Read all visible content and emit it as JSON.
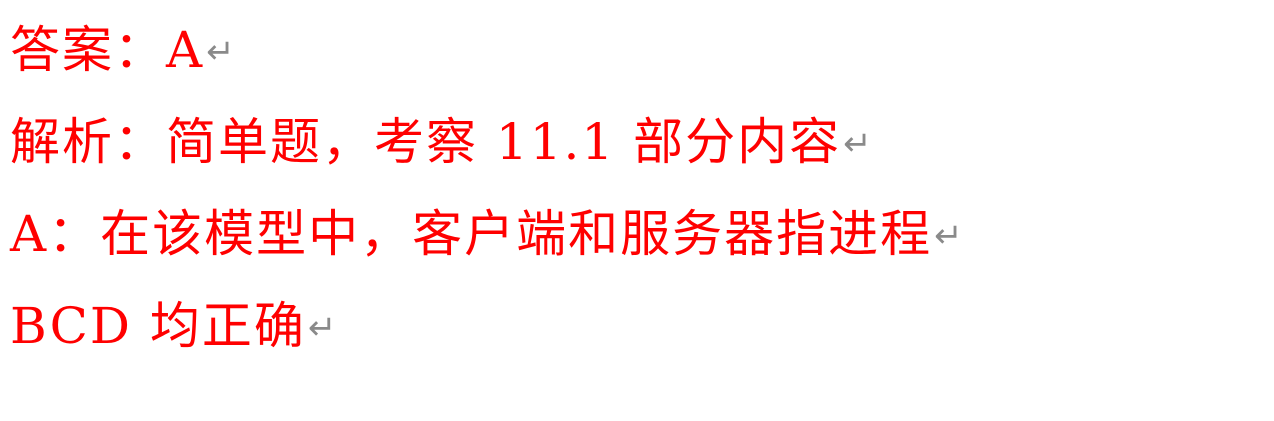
{
  "document": {
    "text_color": "#ff0000",
    "mark_color": "#8a8a8a",
    "paragraph_mark": "↵",
    "lines": [
      {
        "text": "答案：A"
      },
      {
        "text": "解析：简单题，考察 11.1 部分内容"
      },
      {
        "text": "A：在该模型中，客户端和服务器指进程"
      },
      {
        "text": "BCD 均正确"
      }
    ]
  }
}
